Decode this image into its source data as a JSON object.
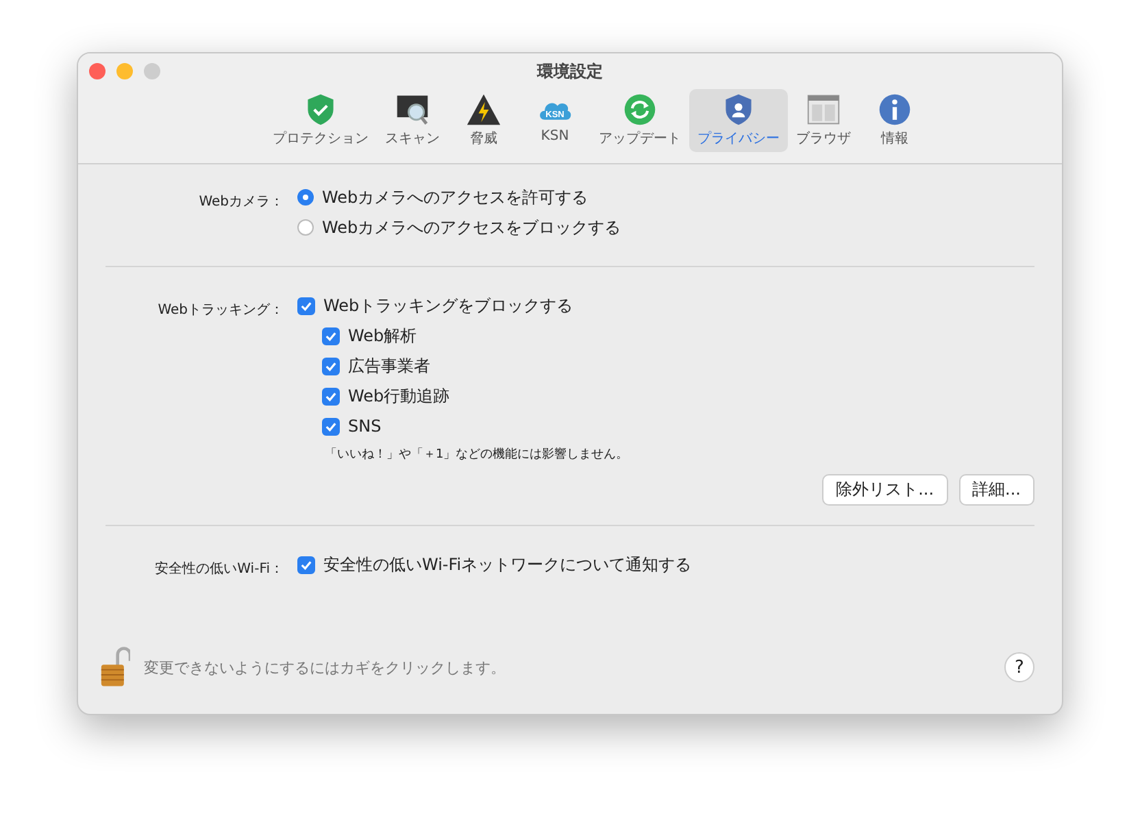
{
  "window": {
    "title": "環境設定"
  },
  "toolbar": [
    {
      "label": "プロテクション",
      "kind": "protection",
      "selected": false
    },
    {
      "label": "スキャン",
      "kind": "scan",
      "selected": false
    },
    {
      "label": "脅威",
      "kind": "threat",
      "selected": false
    },
    {
      "label": "KSN",
      "kind": "ksn",
      "selected": false,
      "icon_text": "KSN"
    },
    {
      "label": "アップデート",
      "kind": "update",
      "selected": false
    },
    {
      "label": "プライバシー",
      "kind": "privacy",
      "selected": true
    },
    {
      "label": "ブラウザ",
      "kind": "browser",
      "selected": false
    },
    {
      "label": "情報",
      "kind": "info",
      "selected": false
    }
  ],
  "webcam": {
    "label": "Webカメラ：",
    "options": [
      {
        "label": "Webカメラへのアクセスを許可する",
        "selected": true
      },
      {
        "label": "Webカメラへのアクセスをブロックする",
        "selected": false
      }
    ]
  },
  "tracking": {
    "label": "Webトラッキング：",
    "main": {
      "label": "Webトラッキングをブロックする",
      "checked": true
    },
    "items": [
      {
        "label": "Web解析",
        "checked": true
      },
      {
        "label": "広告事業者",
        "checked": true
      },
      {
        "label": "Web行動追跡",
        "checked": true
      },
      {
        "label": "SNS",
        "checked": true
      }
    ],
    "note": "「いいね！」や「＋1」などの機能には影響しません。",
    "buttons": [
      "除外リスト...",
      "詳細..."
    ]
  },
  "wifi": {
    "label": "安全性の低いWi-Fi：",
    "option": {
      "label": "安全性の低いWi-Fiネットワークについて通知する",
      "checked": true
    }
  },
  "footer": {
    "lock_text": "変更できないようにするにはカギをクリックします。",
    "help": "?"
  }
}
